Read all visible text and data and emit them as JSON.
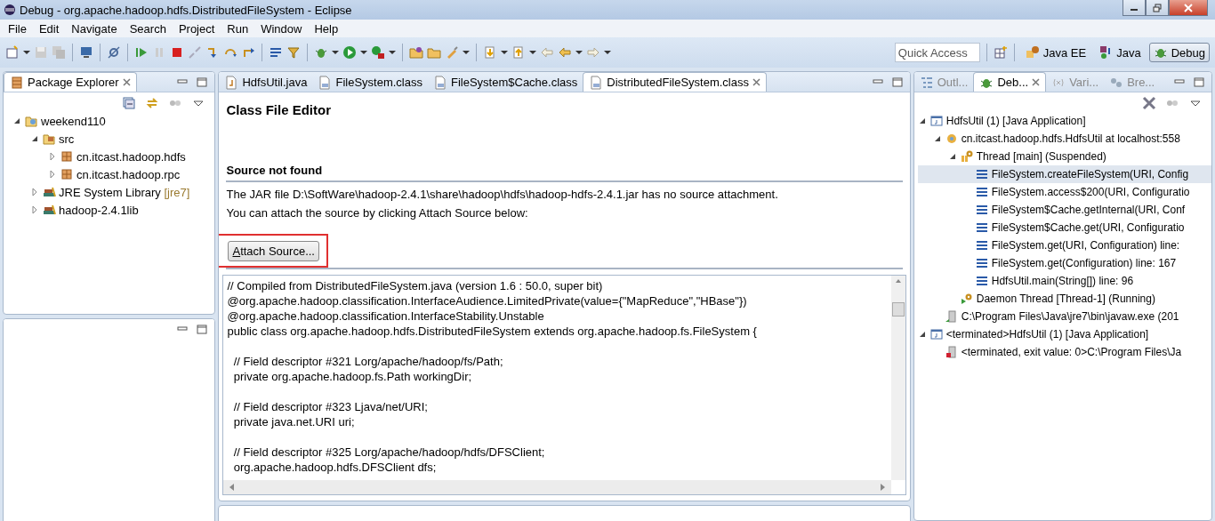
{
  "window": {
    "title": "Debug - org.apache.hadoop.hdfs.DistributedFileSystem - Eclipse"
  },
  "menu": [
    "File",
    "Edit",
    "Navigate",
    "Search",
    "Project",
    "Run",
    "Window",
    "Help"
  ],
  "toolbar": {
    "quick_access": {
      "placeholder": "Quick Access"
    },
    "perspectives": [
      {
        "label": "Java EE",
        "selected": false
      },
      {
        "label": "Java",
        "selected": false
      },
      {
        "label": "Debug",
        "selected": true
      }
    ]
  },
  "package_explorer": {
    "title": "Package Explorer",
    "tree": [
      {
        "label": "weekend110",
        "kind": "project",
        "expanded": true,
        "children": [
          {
            "label": "src",
            "kind": "source-folder",
            "expanded": true,
            "children": [
              {
                "label": "cn.itcast.hadoop.hdfs",
                "kind": "package",
                "expanded": false
              },
              {
                "label": "cn.itcast.hadoop.rpc",
                "kind": "package",
                "expanded": false
              }
            ]
          },
          {
            "label": "JRE System Library",
            "suffix": "[jre7]",
            "kind": "library",
            "expanded": false
          },
          {
            "label": "hadoop-2.4.1lib",
            "kind": "library",
            "expanded": false
          }
        ]
      }
    ]
  },
  "editor": {
    "tabs": [
      {
        "label": "HdfsUtil.java",
        "kind": "java",
        "selected": false
      },
      {
        "label": "FileSystem.class",
        "kind": "class",
        "selected": false
      },
      {
        "label": "FileSystem$Cache.class",
        "kind": "class",
        "selected": false
      },
      {
        "label": "DistributedFileSystem.class",
        "kind": "class",
        "selected": true
      }
    ],
    "heading": "Class File Editor",
    "section_title": "Source not found",
    "messages": [
      "The JAR file D:\\SoftWare\\hadoop-2.4.1\\share\\hadoop\\hdfs\\hadoop-hdfs-2.4.1.jar has no source attachment.",
      "You can attach the source by clicking Attach Source below:"
    ],
    "button": {
      "label": "Attach Source...",
      "highlighted": true
    },
    "code_blocks": [
      [
        "// Compiled from DistributedFileSystem.java (version 1.6 : 50.0, super bit)",
        "@org.apache.hadoop.classification.InterfaceAudience.LimitedPrivate(value={\"MapReduce\",\"HBase\"})",
        "@org.apache.hadoop.classification.InterfaceStability.Unstable",
        "public class org.apache.hadoop.hdfs.DistributedFileSystem extends org.apache.hadoop.fs.FileSystem {"
      ],
      [
        "  // Field descriptor #321 Lorg/apache/hadoop/fs/Path;",
        "  private org.apache.hadoop.fs.Path workingDir;"
      ],
      [
        "  // Field descriptor #323 Ljava/net/URI;",
        "  private java.net.URI uri;"
      ],
      [
        "  // Field descriptor #325 Lorg/apache/hadoop/hdfs/DFSClient;",
        "  org.apache.hadoop.hdfs.DFSClient dfs;"
      ]
    ]
  },
  "debug_view": {
    "tabs": [
      {
        "label": "Outl...",
        "kind": "outline",
        "selected": false
      },
      {
        "label": "Deb...",
        "kind": "debug",
        "selected": true
      },
      {
        "label": "Vari...",
        "kind": "variables",
        "selected": false
      },
      {
        "label": "Bre...",
        "kind": "breakpoints",
        "selected": false
      }
    ],
    "tree": [
      {
        "label": "HdfsUtil (1) [Java Application]",
        "kind": "app",
        "expanded": true,
        "children": [
          {
            "label": "cn.itcast.hadoop.hdfs.HdfsUtil at localhost:558",
            "kind": "target",
            "expanded": true,
            "children": [
              {
                "label": "Thread [main] (Suspended)",
                "kind": "thread",
                "expanded": true,
                "children": [
                  {
                    "label": "FileSystem.createFileSystem(URI, Config",
                    "kind": "frame",
                    "selected": true
                  },
                  {
                    "label": "FileSystem.access$200(URI, Configuratio",
                    "kind": "frame",
                    "selected": false
                  },
                  {
                    "label": "FileSystem$Cache.getInternal(URI, Conf",
                    "kind": "frame",
                    "selected": false
                  },
                  {
                    "label": "FileSystem$Cache.get(URI, Configuratio",
                    "kind": "frame",
                    "selected": false
                  },
                  {
                    "label": "FileSystem.get(URI, Configuration) line:",
                    "kind": "frame",
                    "selected": false
                  },
                  {
                    "label": "FileSystem.get(Configuration) line: 167",
                    "kind": "frame",
                    "selected": false
                  },
                  {
                    "label": "HdfsUtil.main(String[]) line: 96",
                    "kind": "frame",
                    "selected": false
                  }
                ]
              },
              {
                "label": "Daemon Thread [Thread-1] (Running)",
                "kind": "running-thread"
              }
            ]
          },
          {
            "label": "C:\\Program Files\\Java\\jre7\\bin\\javaw.exe (201",
            "kind": "process"
          }
        ]
      },
      {
        "label": "<terminated>HdfsUtil (1) [Java Application]",
        "kind": "app",
        "expanded": true,
        "children": [
          {
            "label": "<terminated, exit value: 0>C:\\Program Files\\Ja",
            "kind": "terminated-process"
          }
        ]
      }
    ]
  }
}
